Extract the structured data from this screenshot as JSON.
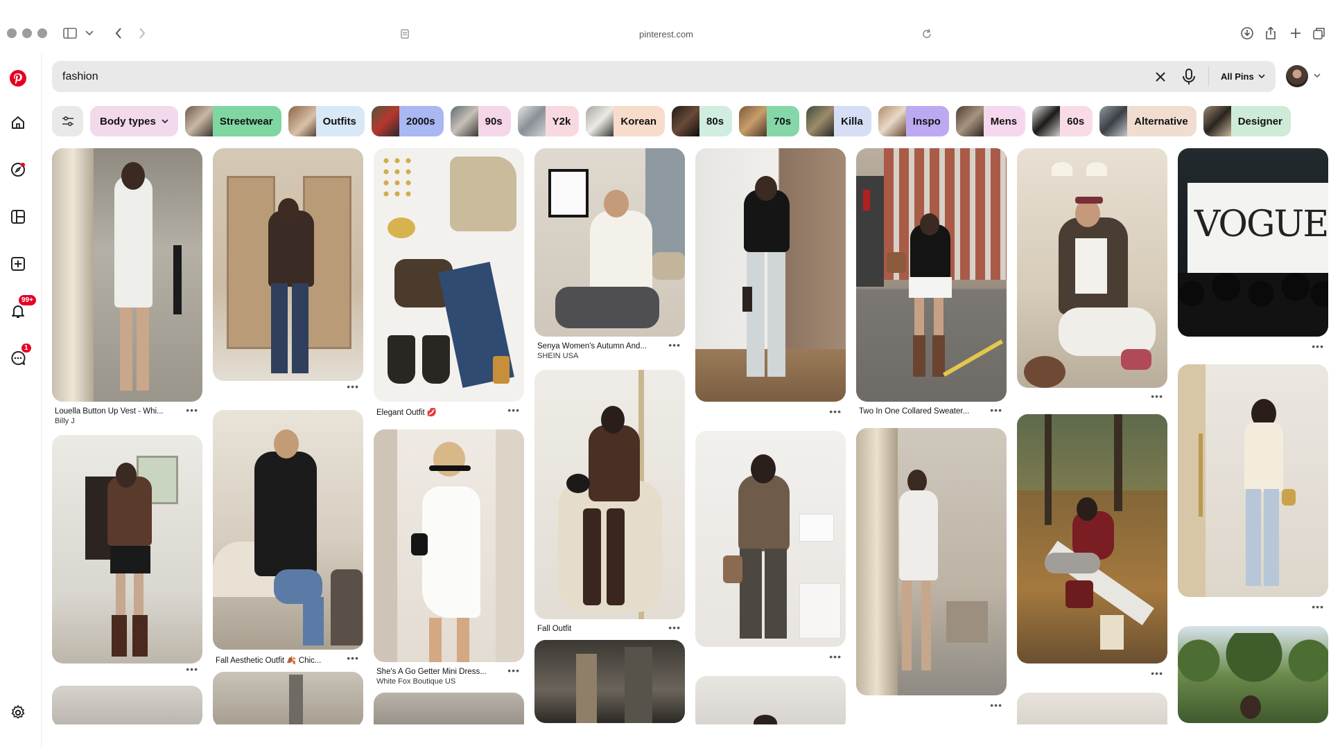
{
  "browser": {
    "url": "pinterest.com"
  },
  "rail": {
    "notifications_badge": "99+",
    "messages_badge": "1"
  },
  "search": {
    "value": "fashion",
    "scope_label": "All Pins"
  },
  "chips": [
    {
      "label": "Body types",
      "color": "#f3d9ec"
    },
    {
      "label": "Streetwear",
      "color": "#7fd6a1"
    },
    {
      "label": "Outfits",
      "color": "#d8e8f7"
    },
    {
      "label": "2000s",
      "color": "#a9b7f2"
    },
    {
      "label": "90s",
      "color": "#f5d6e8"
    },
    {
      "label": "Y2k",
      "color": "#f9d9e0"
    },
    {
      "label": "Korean",
      "color": "#f8dccb"
    },
    {
      "label": "80s",
      "color": "#cfeee0"
    },
    {
      "label": "70s",
      "color": "#86d7a8"
    },
    {
      "label": "Killa",
      "color": "#d5def5"
    },
    {
      "label": "Inspo",
      "color": "#bca9f2"
    },
    {
      "label": "Mens",
      "color": "#f5d8ee"
    },
    {
      "label": "60s",
      "color": "#f8dbe6"
    },
    {
      "label": "Alternative",
      "color": "#f0ddd0"
    },
    {
      "label": "Designer",
      "color": "#cdebd6"
    }
  ],
  "pins": {
    "p1": {
      "title": "Louella Button Up Vest - Whi...",
      "sub": "Billy J"
    },
    "p3": {
      "title": "Elegant Outfit 💋"
    },
    "p4": {
      "title": "Fall Aesthetic Outfit 🍂 Chic..."
    },
    "p5": {
      "title": "She's A Go Getter Mini Dress...",
      "sub": "White Fox Boutique US"
    },
    "p6": {
      "title": "Senya Women's Autumn And...",
      "sub": "SHEIN USA"
    },
    "p7": {
      "title": "Fall Outfit"
    },
    "p8": {
      "title": "Two In One Collared Sweater..."
    },
    "vogue_text": "VOGUE"
  },
  "colors": {
    "brand_red": "#e60023",
    "search_bg": "#e9e9e9"
  }
}
